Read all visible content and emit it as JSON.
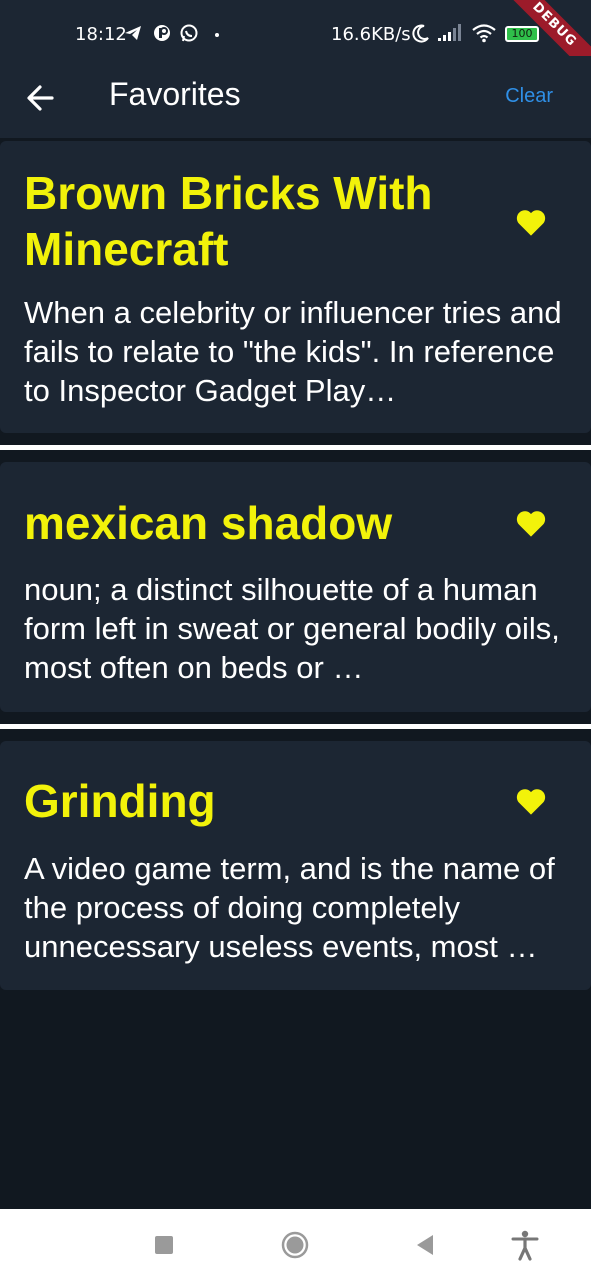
{
  "status_bar": {
    "time": "18:12",
    "net_speed": "16.6KB/s",
    "battery": "100",
    "icons": [
      "telegram-icon",
      "app-notification-icon",
      "whatsapp-icon",
      "dot-icon",
      "moon-icon",
      "signal-icon",
      "wifi-icon",
      "battery-icon"
    ]
  },
  "debug_banner": "DEBUG",
  "app_bar": {
    "back_icon": "arrow-left-icon",
    "title": "Favorites",
    "clear_label": "Clear"
  },
  "favorites": [
    {
      "title": "Brown Bricks With Minecraft",
      "description": "When a celebrity or influencer tries and fails to relate to \"the kids\". In reference to Inspector Gadget Play…",
      "favorited": true
    },
    {
      "title": "mexican shadow",
      "description": "noun; a distinct silhouette of a human form left in sweat or general bodily oils, most often on beds or …",
      "favorited": true
    },
    {
      "title": "Grinding",
      "description": "A video game term, and is the name of the process of doing completely unnecessary useless events, most …",
      "favorited": true
    }
  ],
  "colors": {
    "background": "#111820",
    "surface": "#1c2633",
    "title_accent": "#f2f20a",
    "link": "#2f8fe6",
    "debug_banner": "#9c1b2a"
  },
  "nav_bar": {
    "icons": [
      "recents-square-icon",
      "home-circle-icon",
      "back-triangle-icon",
      "accessibility-icon"
    ]
  }
}
